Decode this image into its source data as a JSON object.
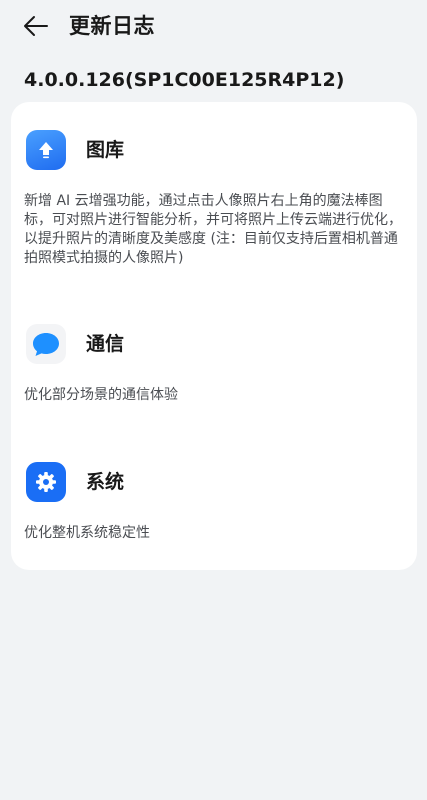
{
  "header": {
    "back_icon": "arrow-left-icon",
    "title": "更新日志"
  },
  "version": "4.0.0.126(SP1C00E125R4P12)",
  "sections": [
    {
      "icon": "gallery-upload-icon",
      "title": "图库",
      "description": "新增 AI 云增强功能，通过点击人像照片右上角的魔法棒图标，可对照片进行智能分析，并可将照片上传云端进行优化，以提升照片的清晰度及美感度 (注：目前仅支持后置相机普通拍照模式拍摄的人像照片)"
    },
    {
      "icon": "message-bubble-icon",
      "title": "通信",
      "description": "优化部分场景的通信体验"
    },
    {
      "icon": "gear-icon",
      "title": "系统",
      "description": "优化整机系统稳定性"
    }
  ],
  "colors": {
    "background": "#f1f3f5",
    "card": "#ffffff",
    "accent": "#1a6ef5",
    "message_blue": "#1e90ff"
  }
}
